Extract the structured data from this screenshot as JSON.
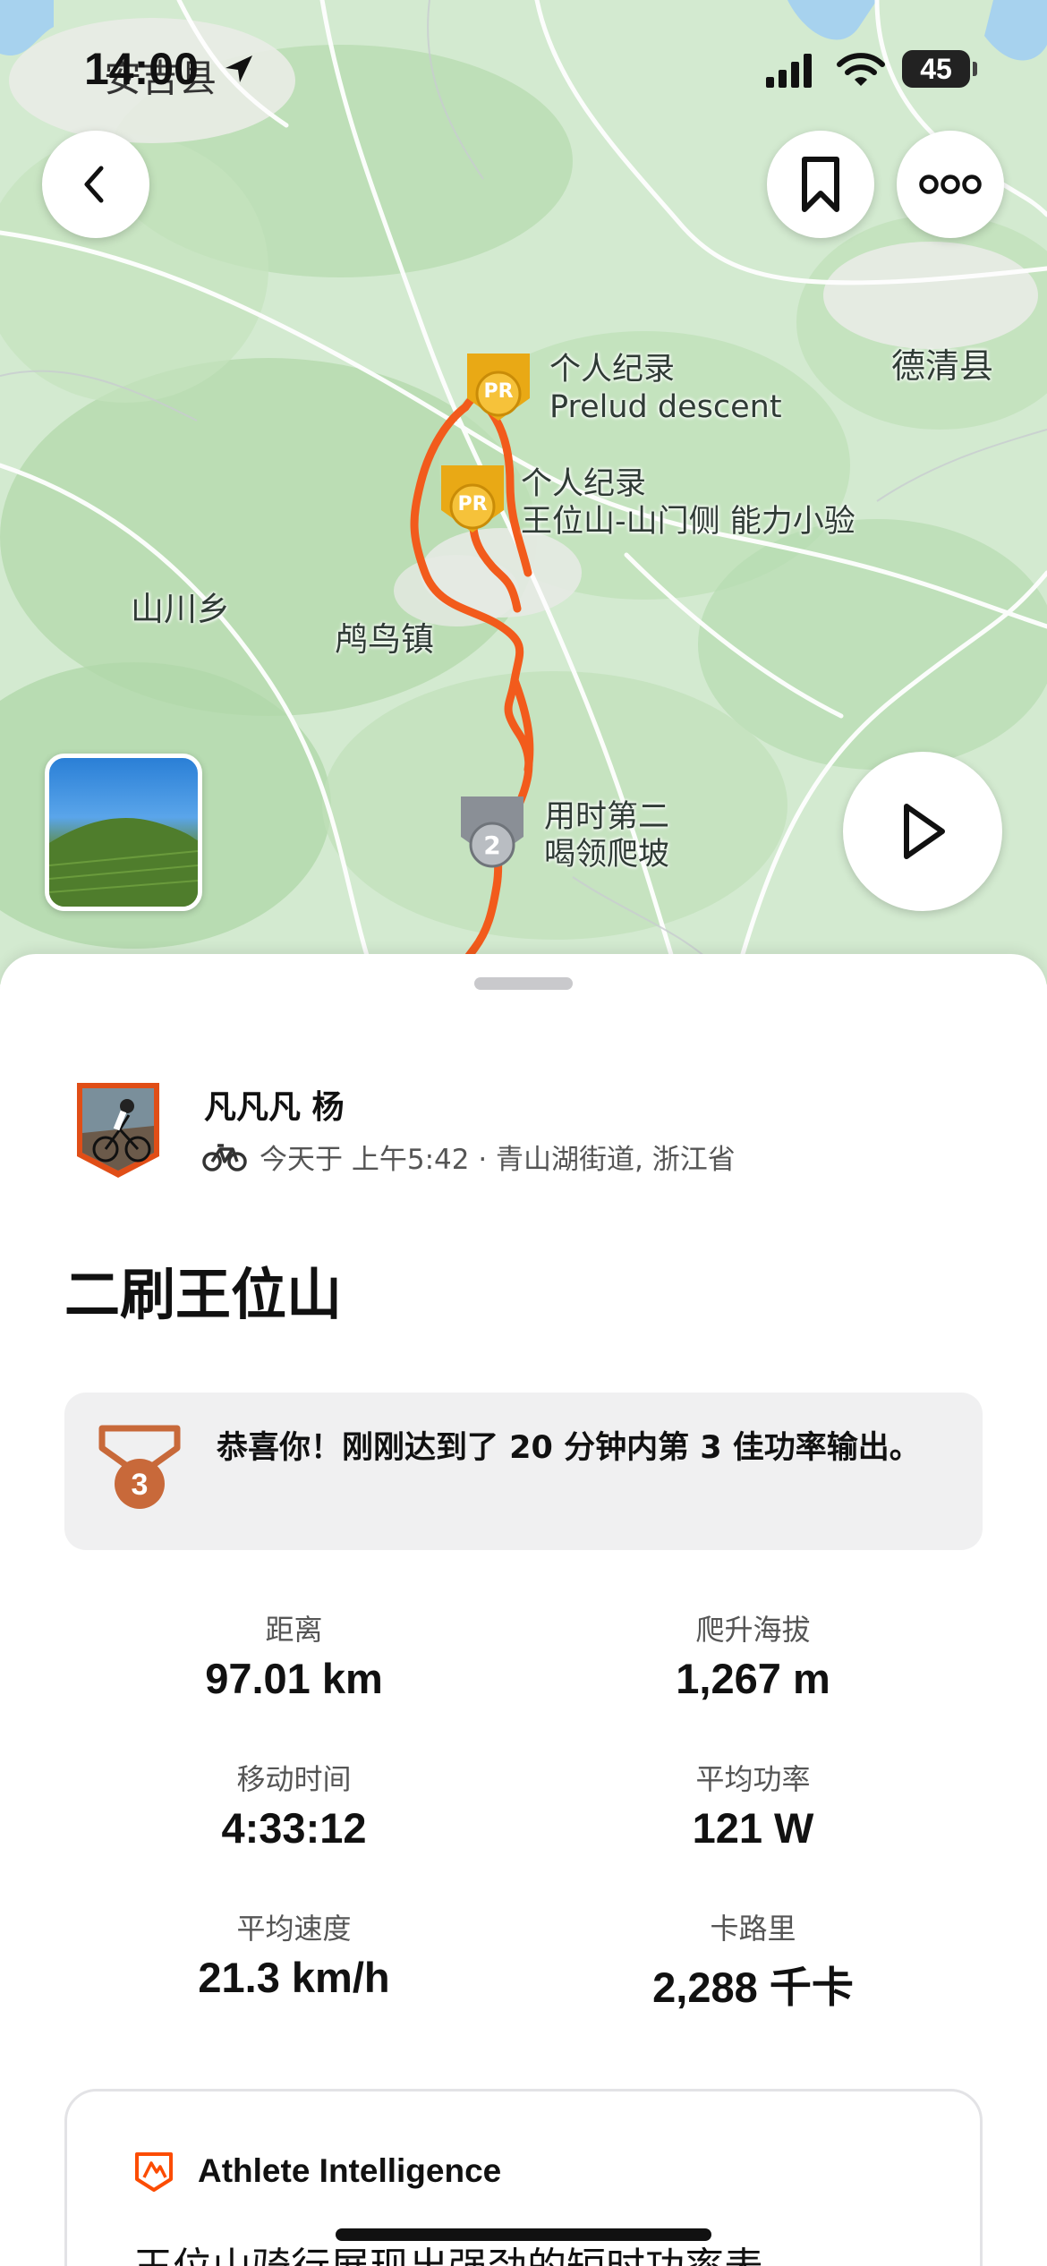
{
  "status_bar": {
    "time": "14:00",
    "location_overlay": "安吉县",
    "battery": "45",
    "icons": [
      "location-arrow-icon",
      "cellular-signal-icon",
      "wifi-icon",
      "battery-icon"
    ]
  },
  "map": {
    "place_labels": {
      "deqing": "德清县",
      "shanchuan": "山川乡",
      "gouniao": "鸬鸟镇"
    },
    "pins": {
      "pr_top": {
        "badge": "PR",
        "line1": "个人纪录",
        "line2": "Prelud descent"
      },
      "pr_mid": {
        "badge": "PR",
        "line1": "个人纪录",
        "line2": "王位山-山门侧  能力小验"
      },
      "second": {
        "badge": "2",
        "line1": "用时第二",
        "line2": "喝领爬坡"
      }
    },
    "colors": {
      "route": "#f25b1c",
      "pr_gold": "#e9a915",
      "silver": "#8a8f96"
    }
  },
  "buttons": {
    "back": "back-chevron-icon",
    "save": "bookmark-icon",
    "more": "more-dots-icon",
    "play": "play-icon"
  },
  "activity": {
    "athlete_name": "凡凡凡 杨",
    "meta": "今天于 上午5:42 · 青山湖街道, 浙江省",
    "title": "二刷王位山"
  },
  "achievement": {
    "rank": "3",
    "text": "恭喜你！刚刚达到了 20 分钟内第 3 佳功率输出。"
  },
  "stats": [
    {
      "label": "距离",
      "value": "97.01 km"
    },
    {
      "label": "爬升海拔",
      "value": "1,267 m"
    },
    {
      "label": "移动时间",
      "value": "4:33:12"
    },
    {
      "label": "平均功率",
      "value": "121 W"
    },
    {
      "label": "平均速度",
      "value": "21.3 km/h"
    },
    {
      "label": "卡路里",
      "value": "2,288 千卡"
    }
  ],
  "ai_card": {
    "title": "Athlete Intelligence",
    "body": "王位山骑行展现出强劲的短时功率表"
  },
  "theme": {
    "accent": "#fc4c02",
    "bronze": "#c8693a"
  }
}
